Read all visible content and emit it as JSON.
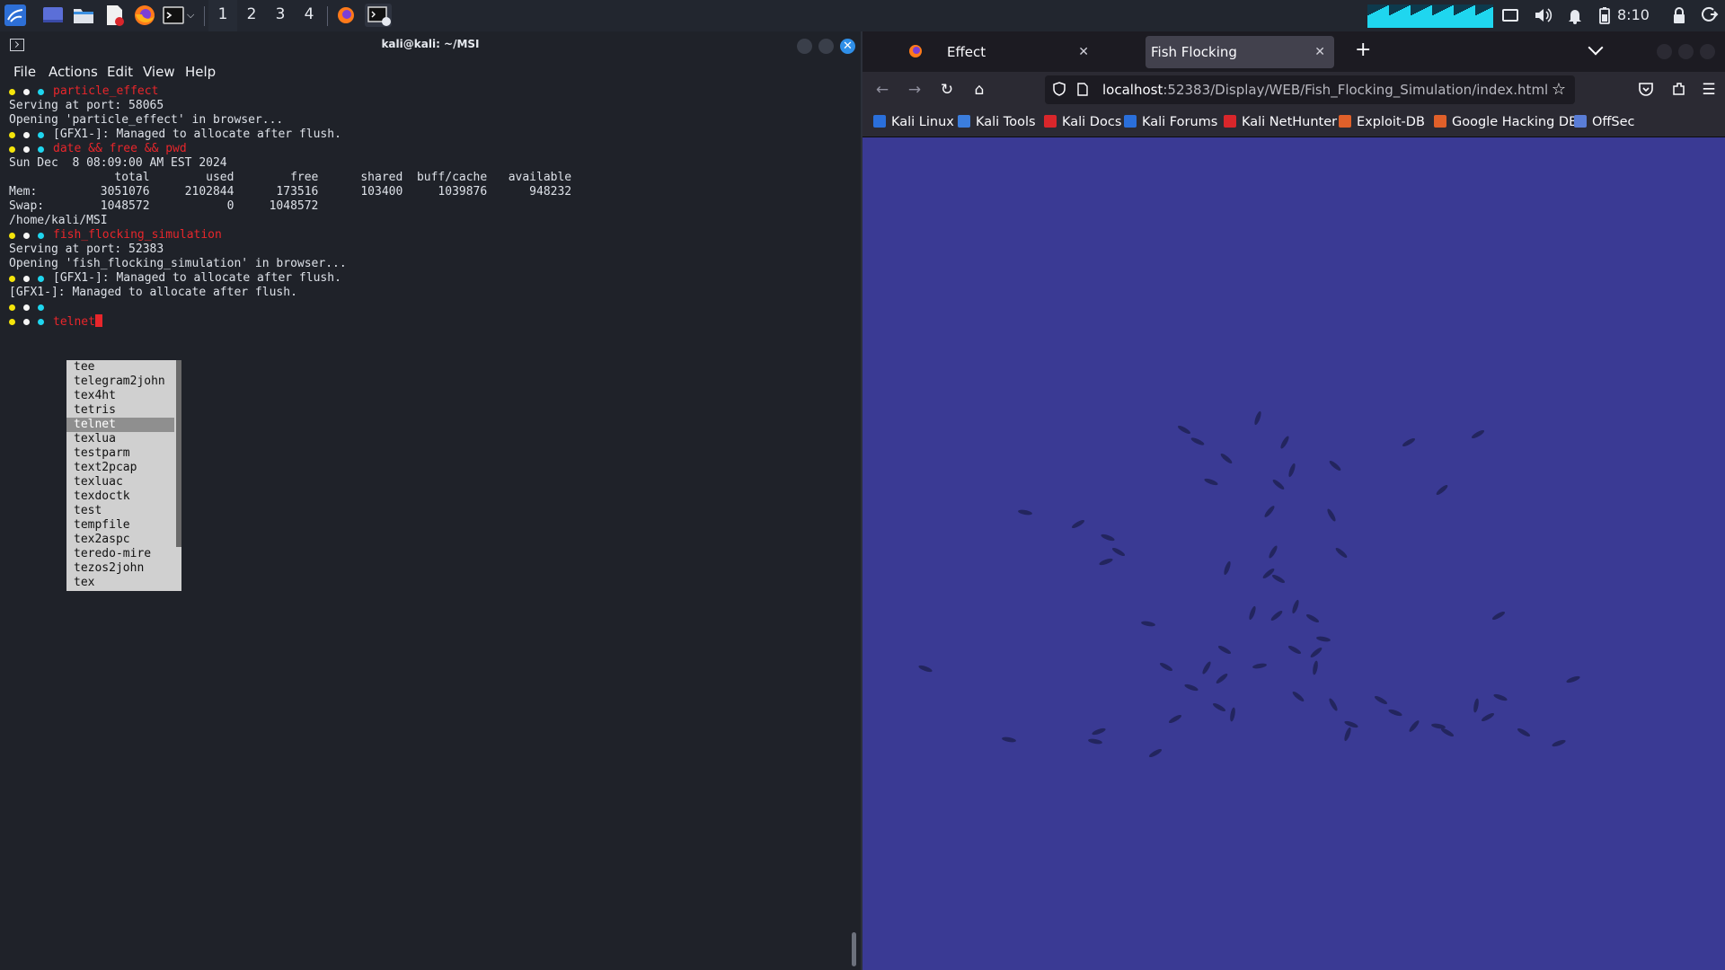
{
  "taskbar": {
    "workspaces": [
      "1",
      "2",
      "3",
      "4"
    ],
    "active_workspace": "1",
    "clock": "8:10"
  },
  "terminal": {
    "title": "kali@kali: ~/MSI",
    "menu": [
      "File",
      "Actions",
      "Edit",
      "View",
      "Help"
    ],
    "lines": [
      {
        "type": "prompt",
        "text": "particle_effect"
      },
      {
        "type": "out",
        "text": "Serving at port: 58065"
      },
      {
        "type": "out",
        "text": "Opening 'particle_effect' in browser..."
      },
      {
        "type": "promptout",
        "text": "[GFX1-]: Managed to allocate after flush."
      },
      {
        "type": "prompt",
        "text": "date && free && pwd"
      },
      {
        "type": "out",
        "text": "Sun Dec  8 08:09:00 AM EST 2024"
      },
      {
        "type": "out",
        "text": "               total        used        free      shared  buff/cache   available"
      },
      {
        "type": "out",
        "text": "Mem:         3051076     2102844      173516      103400     1039876      948232"
      },
      {
        "type": "out",
        "text": "Swap:        1048572           0     1048572"
      },
      {
        "type": "out",
        "text": "/home/kali/MSI"
      },
      {
        "type": "prompt",
        "text": "fish_flocking_simulation"
      },
      {
        "type": "out",
        "text": "Serving at port: 52383"
      },
      {
        "type": "out",
        "text": "Opening 'fish_flocking_simulation' in browser..."
      },
      {
        "type": "promptout",
        "text": "[GFX1-]: Managed to allocate after flush."
      },
      {
        "type": "out",
        "text": "[GFX1-]: Managed to allocate after flush."
      },
      {
        "type": "prompt",
        "text": ""
      },
      {
        "type": "prompt",
        "text": "telnet",
        "cursor": true
      }
    ],
    "completion": {
      "items": [
        "tee",
        "telegram2john",
        "tex4ht",
        "tetris",
        "telnet",
        "texlua",
        "testparm",
        "text2pcap",
        "texluac",
        "texdoctk",
        "test",
        "tempfile",
        "tex2aspc",
        "teredo-mire",
        "tezos2john",
        "tex"
      ],
      "selected": "telnet"
    }
  },
  "firefox": {
    "tabs": [
      {
        "label": "Effect",
        "active": false
      },
      {
        "label": "Fish Flocking",
        "active": true
      }
    ],
    "url_host": "localhost",
    "url_rest": ":52383/Display/WEB/Fish_Flocking_Simulation/index.html",
    "bookmarks": [
      {
        "label": "Kali Linux",
        "color": "#2a6fdb"
      },
      {
        "label": "Kali Tools",
        "color": "#3b7ddd"
      },
      {
        "label": "Kali Docs",
        "color": "#d9262b"
      },
      {
        "label": "Kali Forums",
        "color": "#2a6fdb"
      },
      {
        "label": "Kali NetHunter",
        "color": "#d9262b"
      },
      {
        "label": "Exploit-DB",
        "color": "#e0602a"
      },
      {
        "label": "Google Hacking DB",
        "color": "#e0602a"
      },
      {
        "label": "OffSec",
        "color": "#5a7dd6"
      }
    ]
  },
  "colors": {
    "prompt_dot_1": "#f5e50b",
    "prompt_dot_2": "#f5f5f5",
    "prompt_dot_3": "#1fd6ef",
    "command": "#e8262b",
    "sim_background": "#3a3a94",
    "fish": "#23255e"
  }
}
